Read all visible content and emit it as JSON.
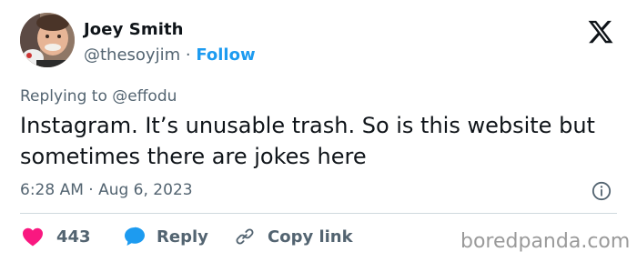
{
  "user": {
    "name": "Joey Smith",
    "handle": "@thesoyjim",
    "separator": "·",
    "follow_label": "Follow"
  },
  "tweet": {
    "replying_prefix": "Replying to",
    "replying_to": "@effodu",
    "text": "Instagram. It’s unusable trash. So is this website but sometimes there are jokes here",
    "timestamp": "6:28 AM · Aug 6, 2023"
  },
  "actions": {
    "like_count": "443",
    "reply_label": "Reply",
    "copy_label": "Copy link"
  },
  "watermark": "boredpanda.com",
  "icons": {
    "logo": "x-logo-icon",
    "info": "info-icon",
    "like": "heart-icon",
    "reply": "speech-bubble-icon",
    "copy": "link-icon"
  },
  "colors": {
    "text": "#0f1419",
    "secondary": "#536471",
    "accent": "#1d9bf0",
    "heart": "#f91880",
    "divider": "#cfd9de"
  }
}
